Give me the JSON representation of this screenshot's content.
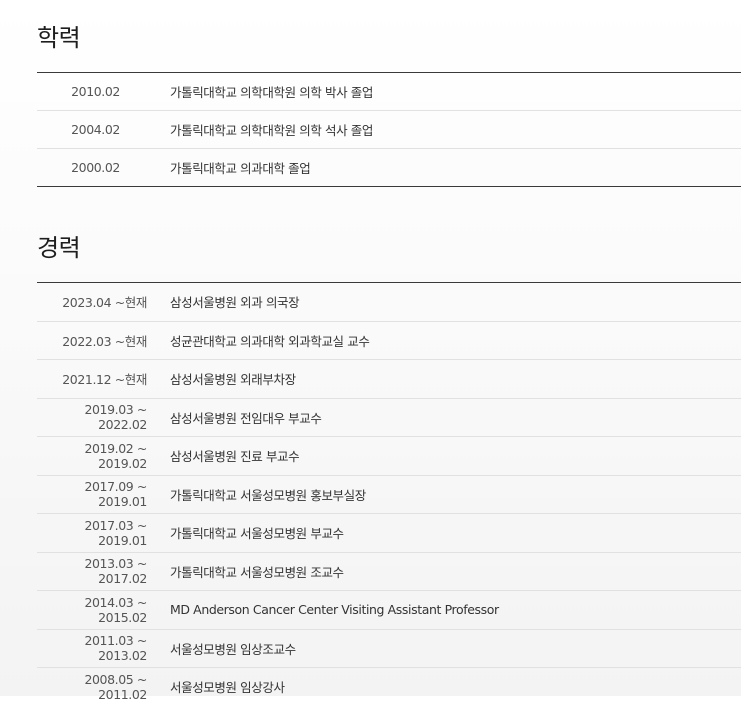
{
  "education": {
    "title": "학력",
    "rows": [
      {
        "period": "2010.02",
        "desc": "가톨릭대학교 의학대학원 의학 박사 졸업"
      },
      {
        "period": "2004.02",
        "desc": "가톨릭대학교 의학대학원 의학 석사 졸업"
      },
      {
        "period": "2000.02",
        "desc": "가톨릭대학교 의과대학 졸업"
      }
    ]
  },
  "career": {
    "title": "경력",
    "rows": [
      {
        "period": "2023.04 ~현재",
        "desc": "삼성서울병원 외과 의국장"
      },
      {
        "period": "2022.03 ~현재",
        "desc": "성균관대학교 의과대학 외과학교실 교수"
      },
      {
        "period": "2021.12 ~현재",
        "desc": "삼성서울병원 외래부차장"
      },
      {
        "period": "2019.03 ~ 2022.02",
        "desc": "삼성서울병원 전임대우 부교수"
      },
      {
        "period": "2019.02 ~ 2019.02",
        "desc": "삼성서울병원 진료 부교수"
      },
      {
        "period": "2017.09 ~ 2019.01",
        "desc": "가톨릭대학교 서울성모병원 홍보부실장"
      },
      {
        "period": "2017.03 ~ 2019.01",
        "desc": "가톨릭대학교 서울성모병원 부교수"
      },
      {
        "period": "2013.03 ~ 2017.02",
        "desc": "가톨릭대학교 서울성모병원 조교수"
      },
      {
        "period": "2014.03 ~ 2015.02",
        "desc": "MD Anderson Cancer Center Visiting Assistant Professor"
      },
      {
        "period": "2011.03 ~ 2013.02",
        "desc": "서울성모병원 임상조교수"
      },
      {
        "period": "2008.05 ~ 2011.02",
        "desc": "서울성모병원 임상강사"
      }
    ]
  }
}
